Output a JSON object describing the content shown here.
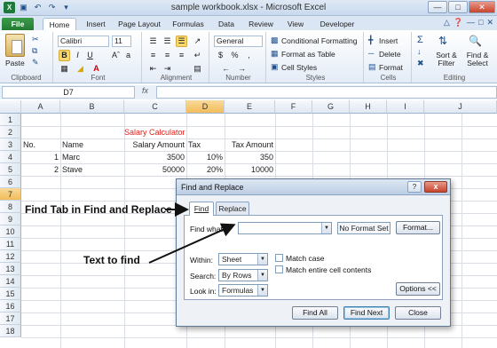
{
  "window": {
    "title": "sample workbook.xlsx - Microsoft Excel",
    "logo": "X"
  },
  "tabs": [
    "File",
    "Home",
    "Insert",
    "Page Layout",
    "Formulas",
    "Data",
    "Review",
    "View",
    "Developer"
  ],
  "ribbon": {
    "clipboard": {
      "label": "Clipboard",
      "paste": "Paste"
    },
    "font": {
      "label": "Font",
      "name": "Calibri",
      "size": "11"
    },
    "alignment": {
      "label": "Alignment"
    },
    "number": {
      "label": "Number",
      "format": "General",
      "currency": "$",
      "percent": "%"
    },
    "styles": {
      "label": "Styles",
      "conditional": "Conditional Formatting",
      "format_table": "Format as Table",
      "cell_styles": "Cell Styles"
    },
    "cells": {
      "label": "Cells",
      "insert": "Insert",
      "delete": "Delete",
      "format": "Format"
    },
    "editing": {
      "label": "Editing",
      "sort_filter": "Sort & Filter",
      "find_select": "Find & Select"
    }
  },
  "formula_bar": {
    "name_box": "D7",
    "fx": "fx",
    "value": ""
  },
  "grid": {
    "columns": [
      "A",
      "B",
      "C",
      "D",
      "E",
      "F",
      "G",
      "H",
      "I",
      "J"
    ],
    "rows": [
      "1",
      "2",
      "3",
      "4",
      "5",
      "6",
      "7",
      "8",
      "9",
      "10",
      "11",
      "12",
      "13",
      "14",
      "15",
      "16",
      "17",
      "18"
    ],
    "title": "Salary Calculator",
    "headers": {
      "no": "No.",
      "name": "Name",
      "salary": "Salary Amount",
      "tax": "Tax",
      "tax_amount": "Tax Amount"
    },
    "records": [
      {
        "no": "1",
        "name": "Marc",
        "salary": "3500",
        "tax": "10%",
        "tax_amount": "350"
      },
      {
        "no": "2",
        "name": "Stave",
        "salary": "50000",
        "tax": "20%",
        "tax_amount": "10000"
      }
    ]
  },
  "dialog": {
    "title": "Find and Replace",
    "help": "?",
    "close": "x",
    "tabs": {
      "find": "Find",
      "replace": "Replace"
    },
    "find_what_label": "Find what:",
    "find_what_value": "",
    "no_format": "No Format Set",
    "format_btn": "Format...",
    "within_label": "Within:",
    "within_value": "Sheet",
    "search_label": "Search:",
    "search_value": "By Rows",
    "lookin_label": "Look in:",
    "lookin_value": "Formulas",
    "match_case": "Match case",
    "match_entire": "Match entire cell contents",
    "options_btn": "Options <<",
    "find_all": "Find All",
    "find_next": "Find Next",
    "close_btn": "Close"
  },
  "annotations": {
    "find_tab": "Find Tab in Find and Replace",
    "text_to_find": "Text to find"
  }
}
